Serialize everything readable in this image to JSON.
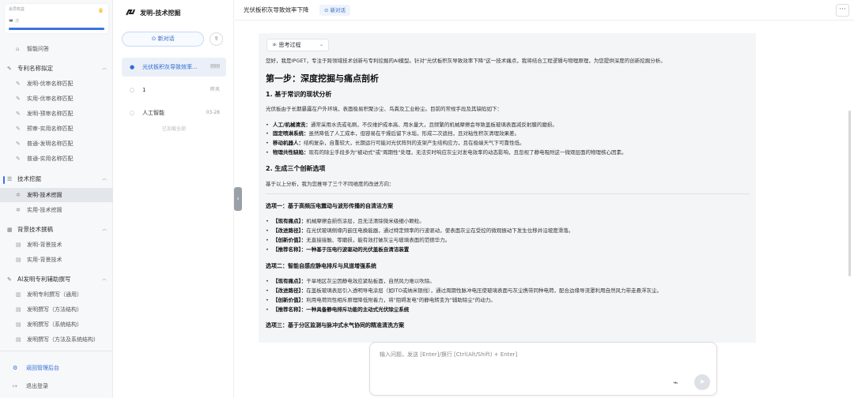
{
  "member": {
    "label": "会员权益",
    "crown_icon": "crown-icon",
    "value": "∞",
    "unit": "次",
    "usage_fraction": 1.0
  },
  "nav": {
    "smart_qa": "智能问答",
    "groups": [
      {
        "label": "专利名称拟定",
        "items": [
          "发明-优审名称匹配",
          "实用-优审名称匹配",
          "发明-预审名称匹配",
          "预审-实用名称匹配",
          "普通-发明名称匹配",
          "普通-实用名称匹配"
        ]
      },
      {
        "label": "技术挖掘",
        "items": [
          "发明-技术挖掘",
          "实用-技术挖掘"
        ]
      },
      {
        "label": "背景技术撰稿",
        "items": [
          "发明-背景技术",
          "实用-背景技术"
        ]
      },
      {
        "label": "AI发明专利辅助撰写",
        "items": [
          "发明专利撰写（通用）",
          "发明撰写（方法结构）",
          "发明撰写（系统结构）",
          "发明撰写（方法及系统结构）"
        ]
      }
    ],
    "footer": {
      "admin": "返回管理后台",
      "logout": "退出登录"
    }
  },
  "conv": {
    "brand": "发明-技术挖掘",
    "new_btn": "新对话",
    "items": [
      {
        "title": "光伏板积灰导致效率...",
        "time": "刚刚"
      },
      {
        "title": "1",
        "time": "昨天"
      },
      {
        "title": "人工智能",
        "time": "03-28"
      }
    ],
    "loaded_all": "已加载全部"
  },
  "topbar": {
    "title": "光伏板积灰导致效率下降",
    "new_conv": "新对话",
    "more": "···"
  },
  "msg": {
    "think": "思考过程",
    "intro": "您好，我是IPGET，专注于跨领域技术创新与专利挖掘的AI模型。针对\"光伏板积灰导致效率下降\"这一技术痛点，我将结合工程逻辑与物理原理，为您提供深度的创新挖掘分析。",
    "step1": "第一步：深度挖掘与痛点剖析",
    "s1": "1. 基于常识的现状分析",
    "s1_text": "光伏板由于长期暴露在户外环境，表面极易积聚沙尘、鸟粪及工业粉尘。目前的常规手段及其缺陷如下：",
    "s1_bullets": [
      {
        "b": "人工/机械清洗：",
        "t": "通常采用水洗或毛刷，不仅维护成本高、用水量大，且频繁的机械摩擦会导致盖板玻璃表面减反射膜的磨损。"
      },
      {
        "b": "固定喷淋系统：",
        "t": "虽然降低了人工成本，但容易在干燥后留下水垢，形成二次遮挡，且对粘性积灰清理效果差。"
      },
      {
        "b": "移动机器人：",
        "t": "结构复杂，自重较大，长期运行可能对光伏阵列的支架产生结构应力，且在极端天气下可靠性低。"
      },
      {
        "b": "物理共性缺陷：",
        "t": "现有的除尘手段多为\"被动式\"或\"周期性\"处理，无法实时响应灰尘对发电效率的动态影响，且忽视了静电吸附这一微观层面的物理核心因素。"
      }
    ],
    "s2": "2. 生成三个创新选项",
    "s2_text": "基于以上分析，我为您推导了三个不同维度的改进方向：",
    "opt1": "选项一：基于高频压电震动与波形传播的自清洁方案",
    "opt1_bullets": [
      {
        "b": "【现有痛点】：",
        "t": "机械摩擦会损伤涂层，且无法清除微米级细小颗粒。"
      },
      {
        "b": "【改进路径】：",
        "t": "在光伏玻璃侧缘内嵌压电换能器，通过特定频率的行波驱动，使表面灰尘在受控的微观振动下发生位移并沿坡度滑落。"
      },
      {
        "b": "【创新价值】：",
        "t": "无直接接触、零磨损，能有效打破灰尘与玻璃表面的范德华力。"
      },
      {
        "b": "【推荐名称】：",
        "t": "一种基于压电行波驱动的光伏盖板自清洁装置"
      }
    ],
    "opt2": "选项二：智能自感应静电排斥与风道增强系统",
    "opt2_bullets": [
      {
        "b": "【现有痛点】：",
        "t": "干旱地区灰尘因静电效应紧贴板面，自然风力难以吹除。"
      },
      {
        "b": "【改进路径】：",
        "t": "在盖板玻璃表层引入透明导电涂层（如ITO或纳米银线），通过周期性脉冲电压使玻璃表面与灰尘携带同种电荷，配合边缘导流罩利用自然风力带走悬浮灰尘。"
      },
      {
        "b": "【创新价值】：",
        "t": "利用电荷同性相斥原理降低附着力，将\"阻碍发电\"的静电转变为\"辅助除尘\"的动力。"
      },
      {
        "b": "【推荐名称】：",
        "t": "一种具备静电排斥功能的主动式光伏除尘系统"
      }
    ],
    "opt3": "选项三：基于分区监测与脉冲式水气协同的精准清洗方案"
  },
  "input": {
    "placeholder": "输入问题，发送 [Enter]/换行 [Ctrl(Alt/Shift) + Enter]",
    "attach_icon": "paperclip-icon",
    "send_icon": "send-icon"
  }
}
